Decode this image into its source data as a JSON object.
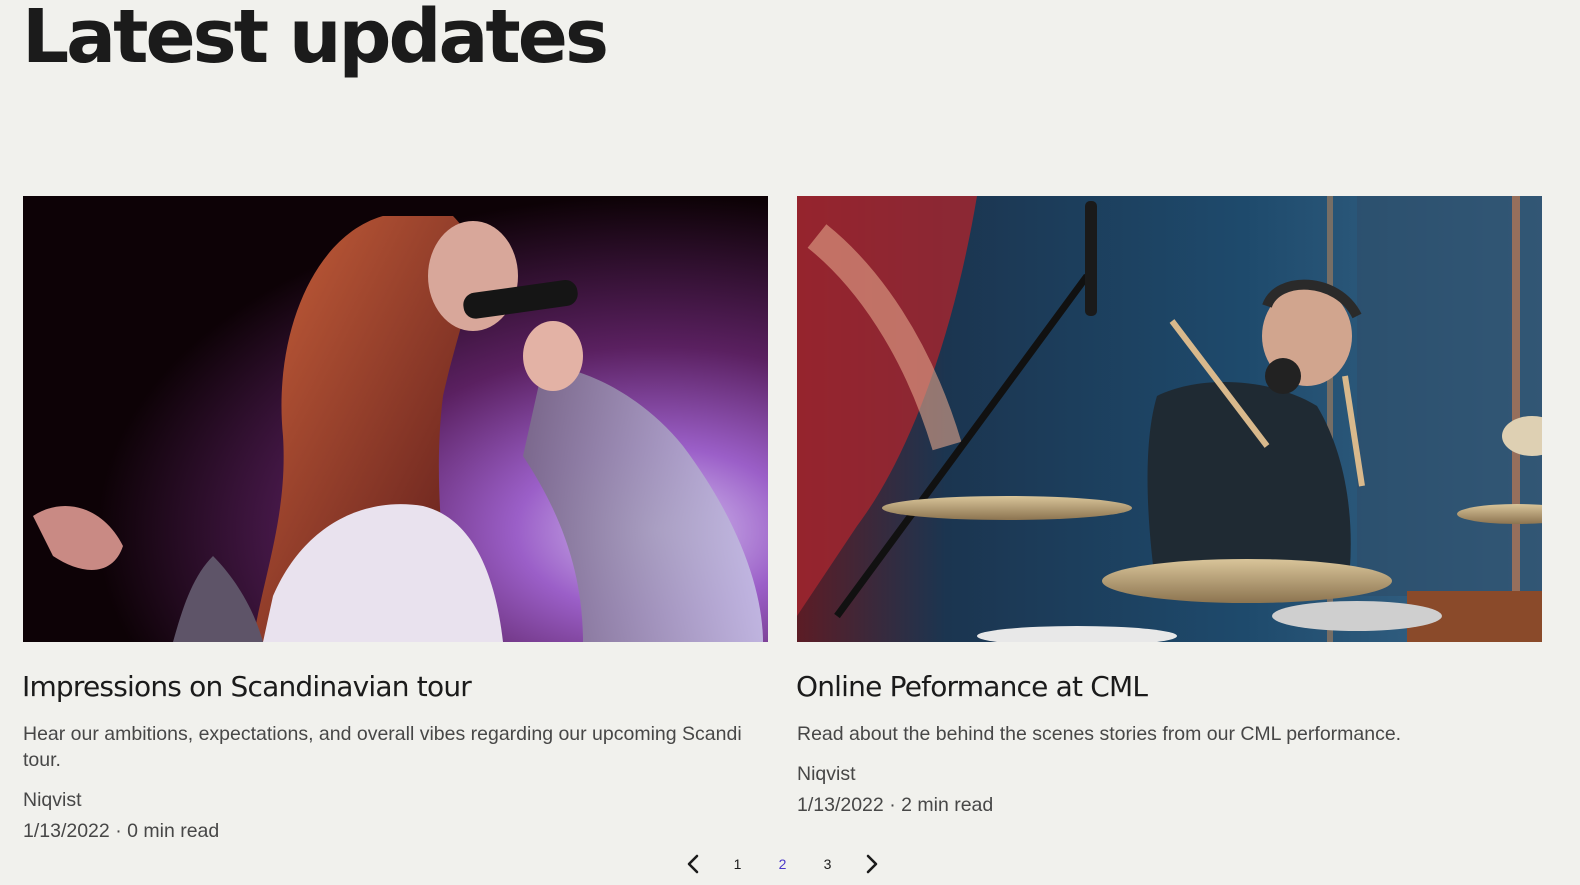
{
  "header": {
    "title": "Latest updates"
  },
  "posts": [
    {
      "image_alt": "Singer performing with microphone under purple stage lights",
      "title": "Impressions on Scandinavian tour",
      "description": "Hear our ambitions, expectations, and overall vibes regarding our upcoming Scandi tour.",
      "author": "Niqvist",
      "date": "1/13/2022",
      "separator": "·",
      "read_time": "0 min read"
    },
    {
      "image_alt": "Drummer with headphones playing drums in a studio",
      "title": "Online Peformance at CML",
      "description": "Read about the behind the scenes stories from our CML performance.",
      "author": "Niqvist",
      "date": "1/13/2022",
      "separator": "·",
      "read_time": "2 min read"
    }
  ],
  "pagination": {
    "prev_icon": "chevron-left-icon",
    "next_icon": "chevron-right-icon",
    "pages": [
      "1",
      "2",
      "3"
    ],
    "current": "2",
    "active_color": "#4a38c9"
  }
}
